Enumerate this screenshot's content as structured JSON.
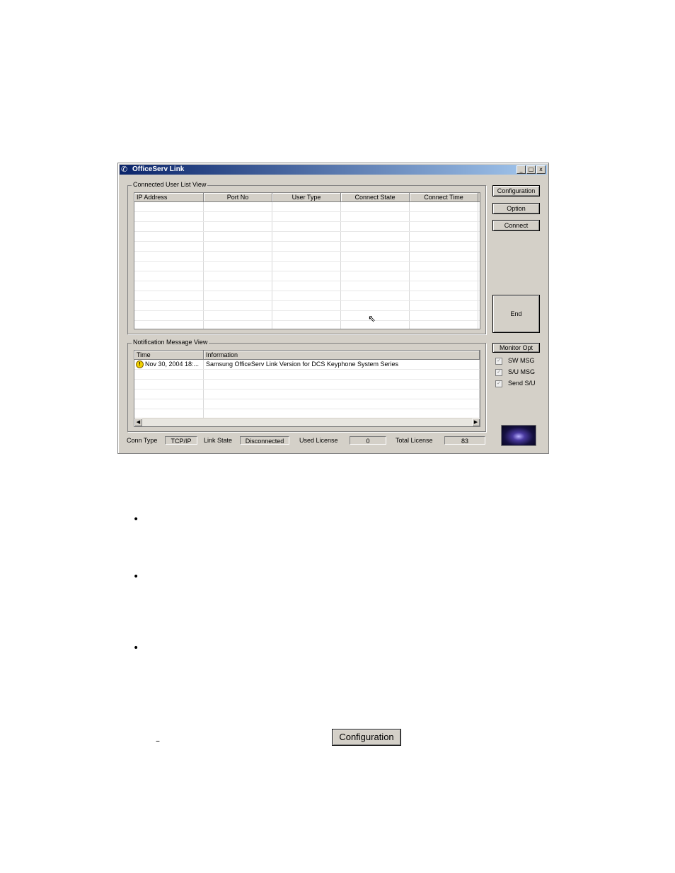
{
  "window": {
    "icon": "app-icon",
    "title": "OfficeServ Link",
    "controls": [
      "_",
      "□",
      "x"
    ]
  },
  "user_list": {
    "label": "Connected User List View",
    "columns": [
      "IP Address",
      "Port No",
      "User Type",
      "Connect State",
      "Connect Time"
    ]
  },
  "buttons": {
    "configuration": "Configuration",
    "option": "Option",
    "connect": "Connect",
    "end": "End",
    "monitor_opt": "Monitor Opt"
  },
  "notification": {
    "label": "Notification Message View",
    "columns": [
      "Time",
      "Information"
    ],
    "rows": [
      {
        "icon": "warning-icon",
        "time": "Nov 30, 2004 18:...",
        "info": "Samsung OfficeServ Link Version for DCS Keyphone System Series"
      }
    ]
  },
  "monitor_options": [
    {
      "label": "SW MSG",
      "checked": true
    },
    {
      "label": "S/U MSG",
      "checked": true
    },
    {
      "label": "Send S/U",
      "checked": true
    }
  ],
  "status_bar": {
    "conn_type_label": "Conn Type",
    "conn_type_value": "TCP/IP",
    "link_state_label": "Link State",
    "link_state_value": "Disconnected",
    "used_license_label": "Used License",
    "used_license_value": "0",
    "total_license_label": "Total License",
    "total_license_value": "83"
  },
  "document": {
    "bullets": [
      "•",
      "•",
      "•"
    ],
    "dash": "–",
    "inline_button": "Configuration"
  }
}
